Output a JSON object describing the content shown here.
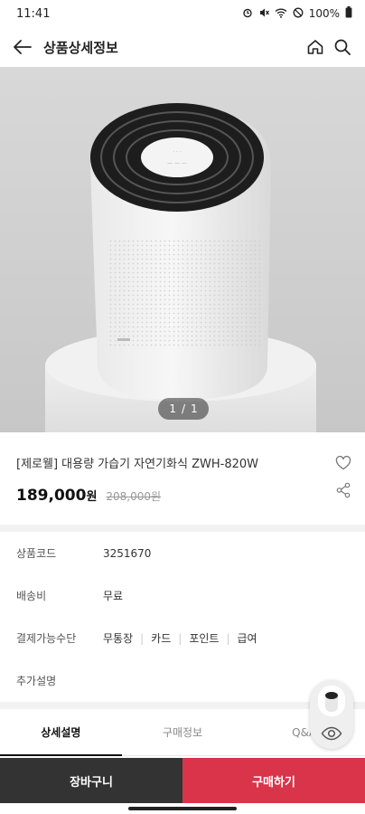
{
  "status_bar": {
    "time": "11:41",
    "battery": "100%"
  },
  "header": {
    "title": "상품상세정보"
  },
  "gallery": {
    "current": "1",
    "separator": "/",
    "total": "1"
  },
  "product": {
    "name": "[제로웰] 대용량 가습기 자연기화식 ZWH-820W",
    "price": "189,000",
    "price_unit": "원",
    "original_price": "208,000원"
  },
  "info": {
    "rows": [
      {
        "label": "상품코드",
        "value": "3251670"
      },
      {
        "label": "배송비",
        "value": "무료"
      },
      {
        "label": "결제가능수단",
        "methods": [
          "무통장",
          "카드",
          "포인트",
          "급여"
        ]
      },
      {
        "label": "추가설명",
        "value": ""
      }
    ]
  },
  "tabs": [
    {
      "label": "상세설명",
      "active": true
    },
    {
      "label": "구매정보",
      "active": false
    },
    {
      "label": "Q&A",
      "active": false
    }
  ],
  "bottom_bar": {
    "cart_label": "장바구니",
    "buy_label": "구매하기"
  },
  "colors": {
    "buy": "#d9344a",
    "cart": "#333333",
    "accent_text": "#111111"
  },
  "icons": [
    "back-arrow-icon",
    "home-icon",
    "search-icon",
    "heart-icon",
    "share-icon",
    "eye-icon"
  ]
}
